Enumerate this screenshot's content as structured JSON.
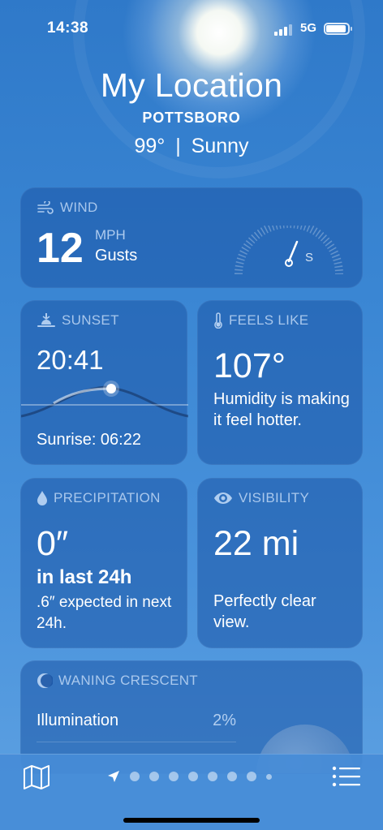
{
  "status_bar": {
    "time": "14:38",
    "network": "5G"
  },
  "header": {
    "title": "My Location",
    "place": "POTTSBORO",
    "temperature": "99°",
    "condition": "Sunny"
  },
  "wind": {
    "label": "WIND",
    "speed": "12",
    "unit": "MPH",
    "gusts_label": "Gusts",
    "direction": "S"
  },
  "sunset": {
    "label": "SUNSET",
    "time": "20:41",
    "sunrise": "Sunrise: 06:22"
  },
  "feels_like": {
    "label": "FEELS LIKE",
    "value": "107°",
    "description": "Humidity is making it feel hotter."
  },
  "precipitation": {
    "label": "PRECIPITATION",
    "value": "0″",
    "period": "in last 24h",
    "description": ".6″ expected in next 24h."
  },
  "visibility": {
    "label": "VISIBILITY",
    "value": "22 mi",
    "description": "Perfectly clear view."
  },
  "moon": {
    "label": "WANING CRESCENT",
    "rows": [
      {
        "name": "Illumination",
        "value": "2%"
      }
    ]
  },
  "bottom_bar": {
    "page_dots": 7,
    "active_page": 0
  },
  "colors": {
    "background": "#3a86d3",
    "card": "#1c56a5",
    "label": "#bed7f5"
  },
  "icons": [
    "wind-icon",
    "sunset-icon",
    "thermometer-icon",
    "drop-icon",
    "eye-icon",
    "moon-icon",
    "map-icon",
    "location-arrow-icon",
    "list-icon"
  ]
}
